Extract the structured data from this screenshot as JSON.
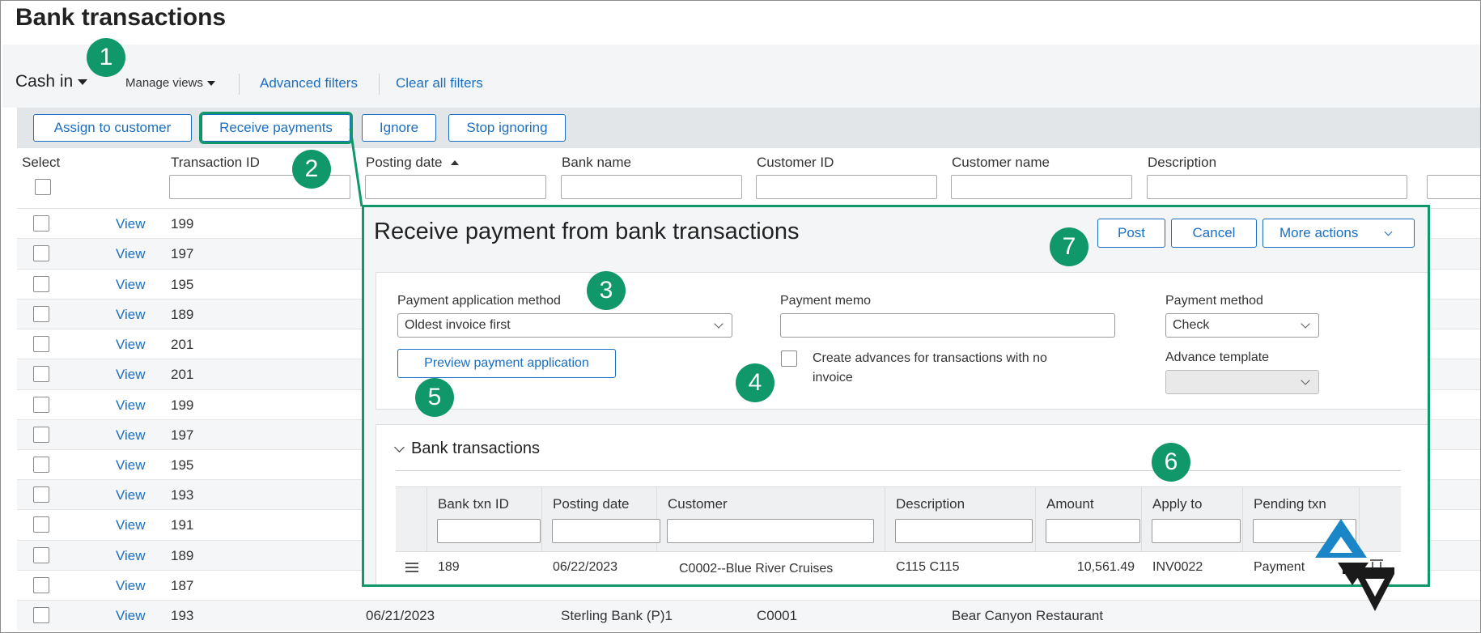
{
  "page": {
    "title": "Bank transactions"
  },
  "view": {
    "selected": "Cash in",
    "manage_views": "Manage views"
  },
  "filters": {
    "advanced": "Advanced filters",
    "clear": "Clear all filters"
  },
  "toolbar": {
    "assign": "Assign to customer",
    "receive": "Receive payments",
    "ignore": "Ignore",
    "stop_ignoring": "Stop ignoring"
  },
  "grid": {
    "columns": [
      "Select",
      "Transaction ID",
      "Posting date",
      "Bank name",
      "Customer ID",
      "Customer name",
      "Description"
    ],
    "view_label": "View",
    "rows": [
      {
        "id": "199"
      },
      {
        "id": "197"
      },
      {
        "id": "195"
      },
      {
        "id": "189"
      },
      {
        "id": "201"
      },
      {
        "id": "201"
      },
      {
        "id": "199"
      },
      {
        "id": "197"
      },
      {
        "id": "195"
      },
      {
        "id": "193"
      },
      {
        "id": "191"
      },
      {
        "id": "189"
      },
      {
        "id": "187"
      },
      {
        "id": "193",
        "posting_date": "06/21/2023",
        "bank_name": "Sterling Bank (P)1",
        "customer_id": "C0001",
        "customer_name": "Bear Canyon Restaurant"
      }
    ]
  },
  "modal": {
    "title": "Receive payment from bank transactions",
    "post": "Post",
    "cancel": "Cancel",
    "more_actions": "More actions",
    "payment_application_method": {
      "label": "Payment application method",
      "value": "Oldest invoice first"
    },
    "preview_button": "Preview payment application",
    "payment_memo": {
      "label": "Payment memo",
      "value": ""
    },
    "create_advances": {
      "line1": "Create advances for transactions with no",
      "line2": "invoice"
    },
    "payment_method": {
      "label": "Payment method",
      "value": "Check"
    },
    "advance_template": {
      "label": "Advance template",
      "value": ""
    },
    "bank_transactions": {
      "title": "Bank transactions",
      "columns": [
        "Bank txn ID",
        "Posting date",
        "Customer",
        "Description",
        "Amount",
        "Apply to",
        "Pending txn"
      ],
      "row": {
        "bank_txn_id": "189",
        "posting_date": "06/22/2023",
        "customer": "C0002--Blue River Cruises",
        "description": "C115 C115",
        "amount": "10,561.49",
        "apply_to": "INV0022",
        "pending_txn": "Payment"
      }
    }
  },
  "callouts": [
    "1",
    "2",
    "3",
    "4",
    "5",
    "6",
    "7"
  ],
  "colors": {
    "accent": "#10976a",
    "link": "#1a6fc2"
  },
  "icons": [
    "caret-down-icon",
    "chevron-down-icon",
    "drag-handle-icon",
    "trash-icon",
    "brand-logo-icon"
  ]
}
